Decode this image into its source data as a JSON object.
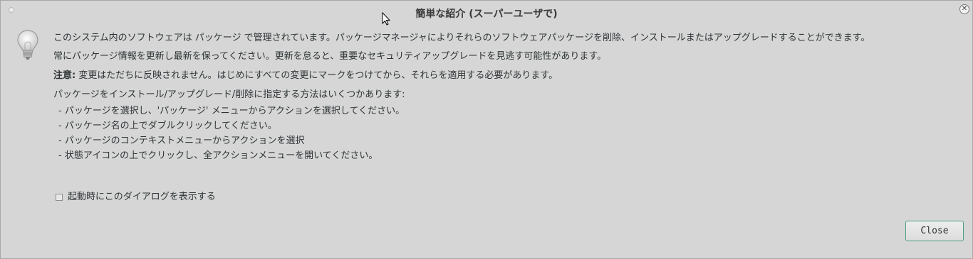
{
  "window": {
    "title": "簡単な紹介 (スーパーユーザで)"
  },
  "intro": {
    "line1": "このシステム内のソフトウェアは パッケージ で管理されています。パッケージマネージャによりそれらのソフトウェアパッケージを削除、インストールまたはアップグレードすることができます。",
    "line2": "常にパッケージ情報を更新し最新を保ってください。更新を怠ると、重要なセキュリティアップグレードを見逃す可能性があります。",
    "note_label": "注意:",
    "note_text": " 変更はただちに反映されません。はじめにすべての変更にマークをつけてから、それらを適用する必要があります。",
    "methods_heading": "パッケージをインストール/アップグレード/削除に指定する方法はいくつかあります:",
    "methods": [
      "- パッケージを選択し、'パッケージ' メニューからアクションを選択してください。",
      "- パッケージ名の上でダブルクリックしてください。",
      "- パッケージのコンテキストメニューからアクションを選択",
      "- 状態アイコンの上でクリックし、全アクションメニューを開いてください。"
    ]
  },
  "startup_checkbox": {
    "label": "起動時にこのダイアログを表示する",
    "checked": false
  },
  "buttons": {
    "close_label": "Close"
  },
  "icons": {
    "window_menu": "window-menu-dot-icon",
    "window_close": "close-icon",
    "info": "lightbulb-icon",
    "cursor": "mouse-pointer-icon"
  }
}
